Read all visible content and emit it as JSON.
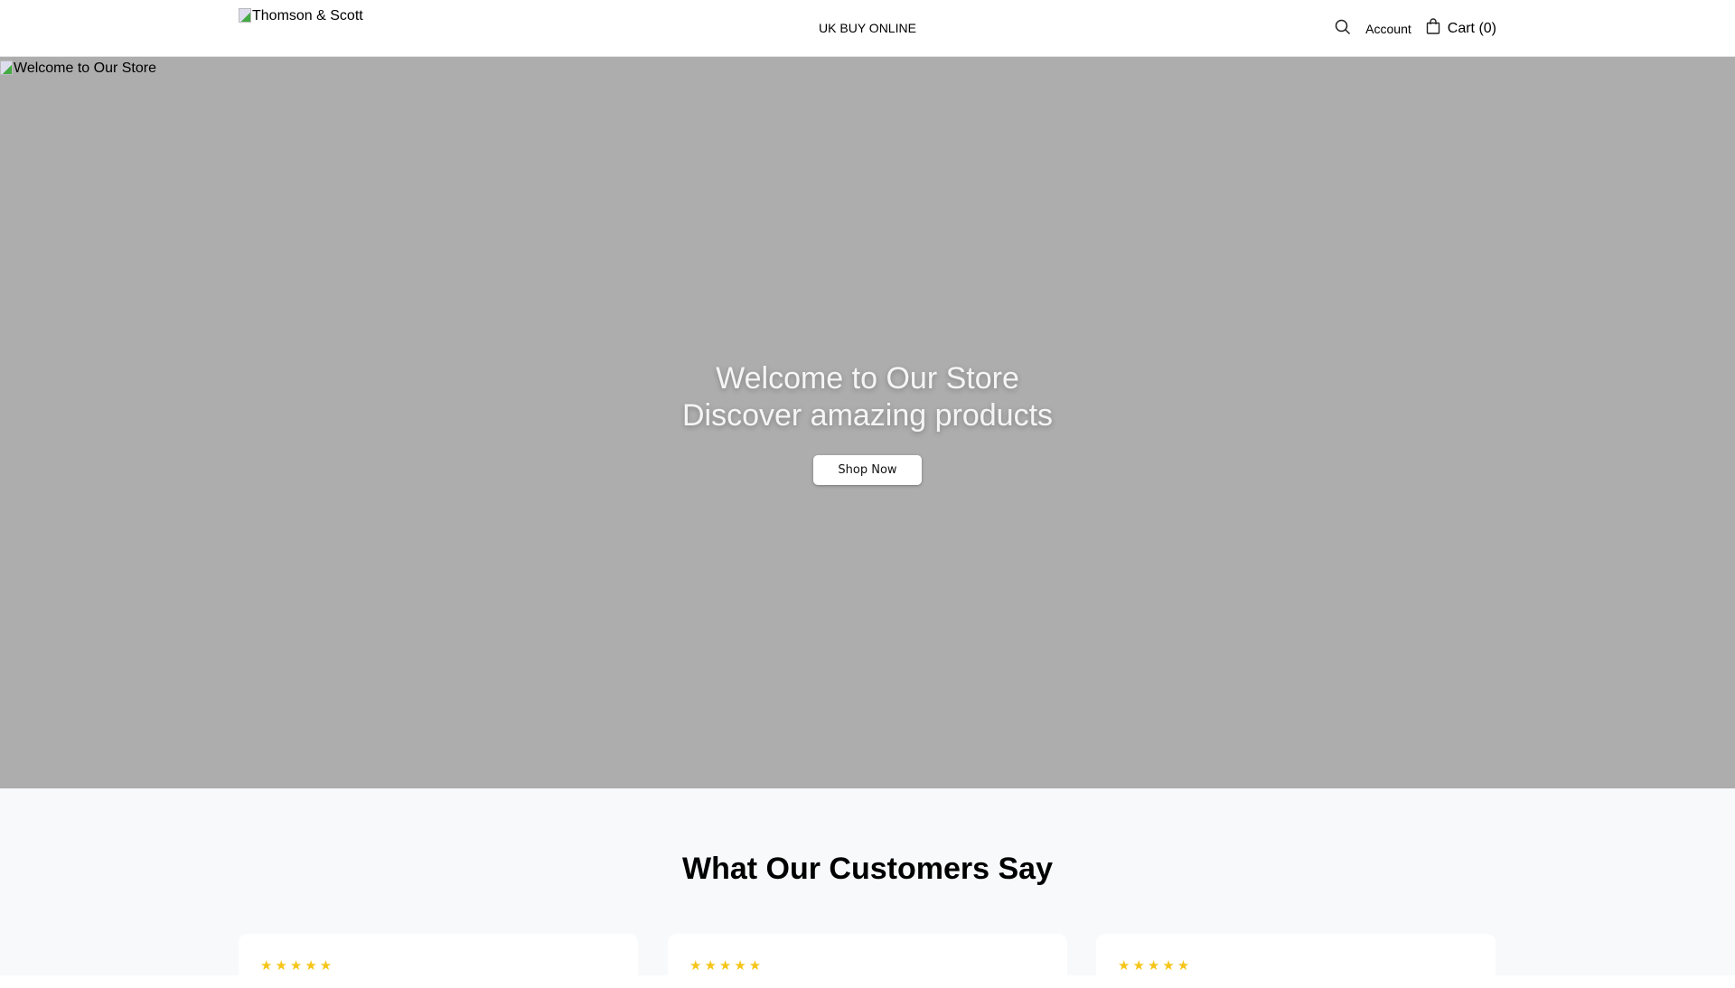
{
  "header": {
    "logo_alt": "Thomson & Scott",
    "nav": "UK BUY ONLINE",
    "account": "Account",
    "cart": "Cart (0)",
    "icons": [
      "search-icon",
      "bag-icon"
    ]
  },
  "hero": {
    "image_alt": "Welcome to Our Store",
    "title": "Welcome to Our Store",
    "subtitle": "Discover amazing products",
    "button": "Shop Now"
  },
  "reviews": {
    "title": "What Our Customers Say",
    "cards": [
      {
        "stars": "★★★★★",
        "rating": 5
      },
      {
        "stars": "★★★★★",
        "rating": 5
      },
      {
        "stars": "★★★★★",
        "rating": 5
      }
    ],
    "star_color": "#f5c518"
  }
}
